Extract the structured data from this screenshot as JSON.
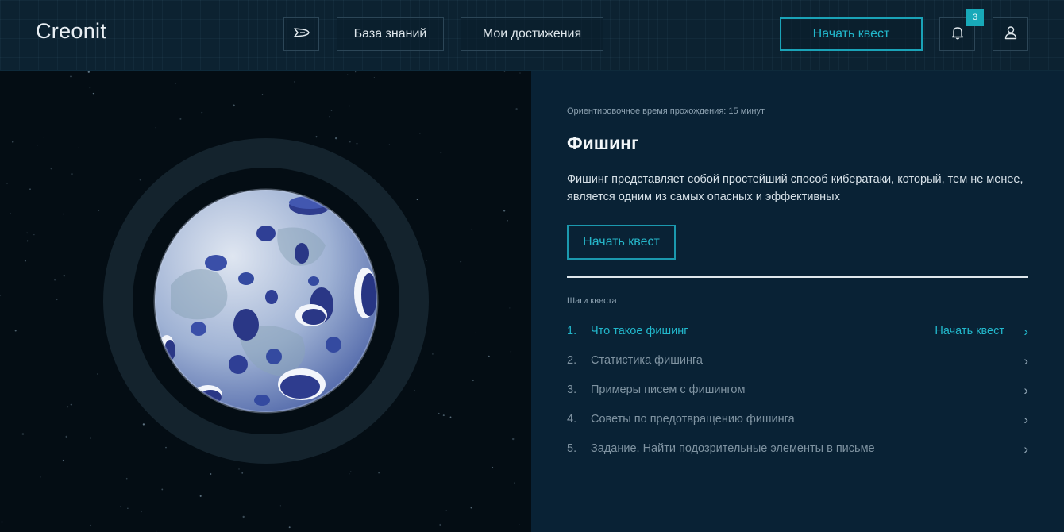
{
  "header": {
    "logo": "Creonit",
    "nav": {
      "ship_icon": "spaceship-icon",
      "knowledge_label": "База знаний",
      "achievements_label": "Мои достижения",
      "start_quest_label": "Начать квест",
      "bell_icon": "bell-icon",
      "notification_count": "3",
      "user_icon": "user-icon"
    }
  },
  "quest": {
    "estimated_time": "Ориентировочное время прохождения: 15 минут",
    "title": "Фишинг",
    "description": "Фишинг представляет собой простейший способ кибератаки, который, тем не менее, является одним из самых опасных и эффективных",
    "start_label": "Начать квест",
    "steps_label": "Шаги квеста",
    "steps": [
      {
        "num": "1.",
        "label": "Что такое фишинг",
        "action": "Начать квест",
        "active": true
      },
      {
        "num": "2.",
        "label": "Статистика фишинга",
        "action": "",
        "active": false
      },
      {
        "num": "3.",
        "label": "Примеры писем с фишингом",
        "action": "",
        "active": false
      },
      {
        "num": "4.",
        "label": "Советы по предотвращению фишинга",
        "action": "",
        "active": false
      },
      {
        "num": "5.",
        "label": "Задание. Найти подозрительные элементы в письме",
        "action": "",
        "active": false
      }
    ]
  },
  "colors": {
    "accent": "#22b8cc",
    "header_bg": "#0c2231",
    "panel_bg": "#092235",
    "space_bg": "#040d14"
  }
}
